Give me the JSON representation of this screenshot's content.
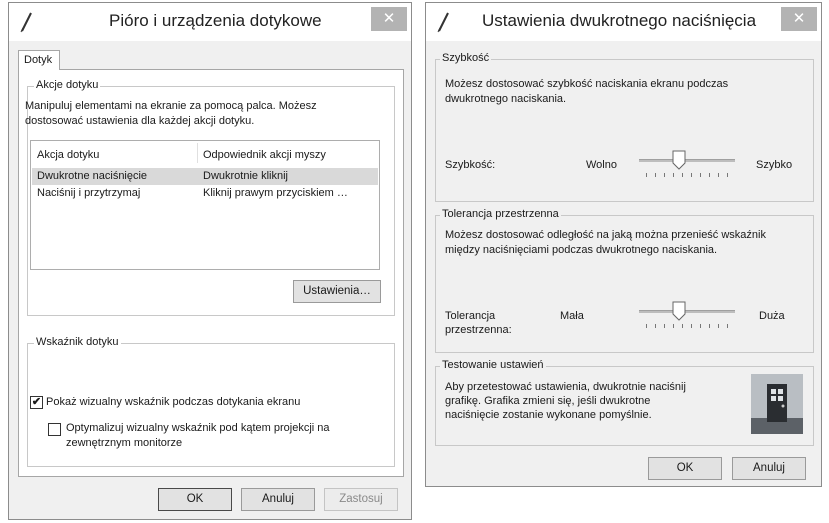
{
  "left_window": {
    "title": "Pióro i urządzenia dotykowe",
    "close_glyph": "✕",
    "tab": "Dotyk",
    "touch_actions": {
      "group_label": "Akcje dotyku",
      "description": "Manipuluj elementami na ekranie za pomocą palca. Możesz dostosować ustawienia dla każdej akcji dotyku.",
      "columns": [
        "Akcja dotyku",
        "Odpowiednik akcji myszy"
      ],
      "rows": [
        {
          "action": "Dwukrotne naciśnięcie",
          "equivalent": "Dwukrotnie kliknij",
          "selected": true
        },
        {
          "action": "Naciśnij i przytrzymaj",
          "equivalent": "Kliknij prawym przyciskiem …",
          "selected": false
        }
      ],
      "settings_button": "Ustawienia…"
    },
    "touch_indicator": {
      "group_label": "Wskaźnik dotyku",
      "show_visual": {
        "label": "Pokaż wizualny wskaźnik podczas dotykania ekranu",
        "checked": true
      },
      "optimize": {
        "label_line1": "Optymalizuj wizualny wskaźnik pod kątem projekcji na",
        "label_line2": "zewnętrznym monitorze",
        "checked": false
      }
    },
    "buttons": {
      "ok": "OK",
      "cancel": "Anuluj",
      "apply": "Zastosuj"
    }
  },
  "right_window": {
    "title": "Ustawienia dwukrotnego naciśnięcia",
    "close_glyph": "✕",
    "speed": {
      "group_label": "Szybkość",
      "description_line1": "Możesz dostosować szybkość naciskania ekranu podczas",
      "description_line2": "dwukrotnego naciskania.",
      "label": "Szybkość:",
      "min_label": "Wolno",
      "max_label": "Szybko",
      "value_fraction": 0.4
    },
    "tolerance": {
      "group_label": "Tolerancja przestrzenna",
      "description_line1": "Możesz dostosować odległość na jaką można przenieść wskaźnik",
      "description_line2": "między naciśnięciami podczas dwukrotnego naciskania.",
      "label_line1": "Tolerancja",
      "label_line2": "przestrzenna:",
      "min_label": "Mała",
      "max_label": "Duża",
      "value_fraction": 0.4
    },
    "test": {
      "group_label": "Testowanie ustawień",
      "description_line1": "Aby przetestować ustawienia, dwukrotnie naciśnij",
      "description_line2": "grafikę. Grafika zmieni się, jeśli dwukrotne",
      "description_line3": "naciśnięcie zostanie wykonane pomyślnie."
    },
    "buttons": {
      "ok": "OK",
      "cancel": "Anuluj"
    }
  },
  "colors": {
    "selected_row": "#d9d9d9",
    "close_button": "#b3b3b3",
    "window_bg": "#f0f0f0"
  },
  "icons": [
    "pen-icon",
    "close-icon",
    "checkmark-icon",
    "door-picture"
  ]
}
